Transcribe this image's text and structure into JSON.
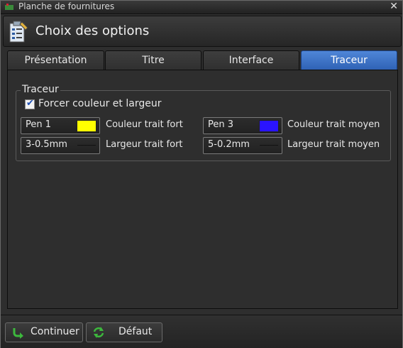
{
  "window": {
    "title": "Planche de fournitures",
    "close_glyph": "✕",
    "icon": "app-icon"
  },
  "header": {
    "title": "Choix des options",
    "icon": "clipboard-pencil-icon"
  },
  "tabs": [
    {
      "label": "Présentation",
      "active": false
    },
    {
      "label": "Titre",
      "active": false
    },
    {
      "label": "Interface",
      "active": false
    },
    {
      "label": "Traceur",
      "active": true
    }
  ],
  "group": {
    "title": "Traceur",
    "checkbox": {
      "label": "Forcer couleur et largeur",
      "checked": true
    },
    "strong_color": {
      "value": "Pen 1",
      "label": "Couleur trait fort",
      "swatch": "#ffff00"
    },
    "medium_color": {
      "value": "Pen 3",
      "label": "Couleur trait moyen",
      "swatch": "#2a14ff"
    },
    "strong_width": {
      "value": "3-0.5mm",
      "label": "Largeur trait fort"
    },
    "medium_width": {
      "value": "5-0.2mm",
      "label": "Largeur trait moyen"
    }
  },
  "footer": {
    "continue_label": "Continuer",
    "default_label": "Défaut",
    "accent": "#3db83d"
  }
}
